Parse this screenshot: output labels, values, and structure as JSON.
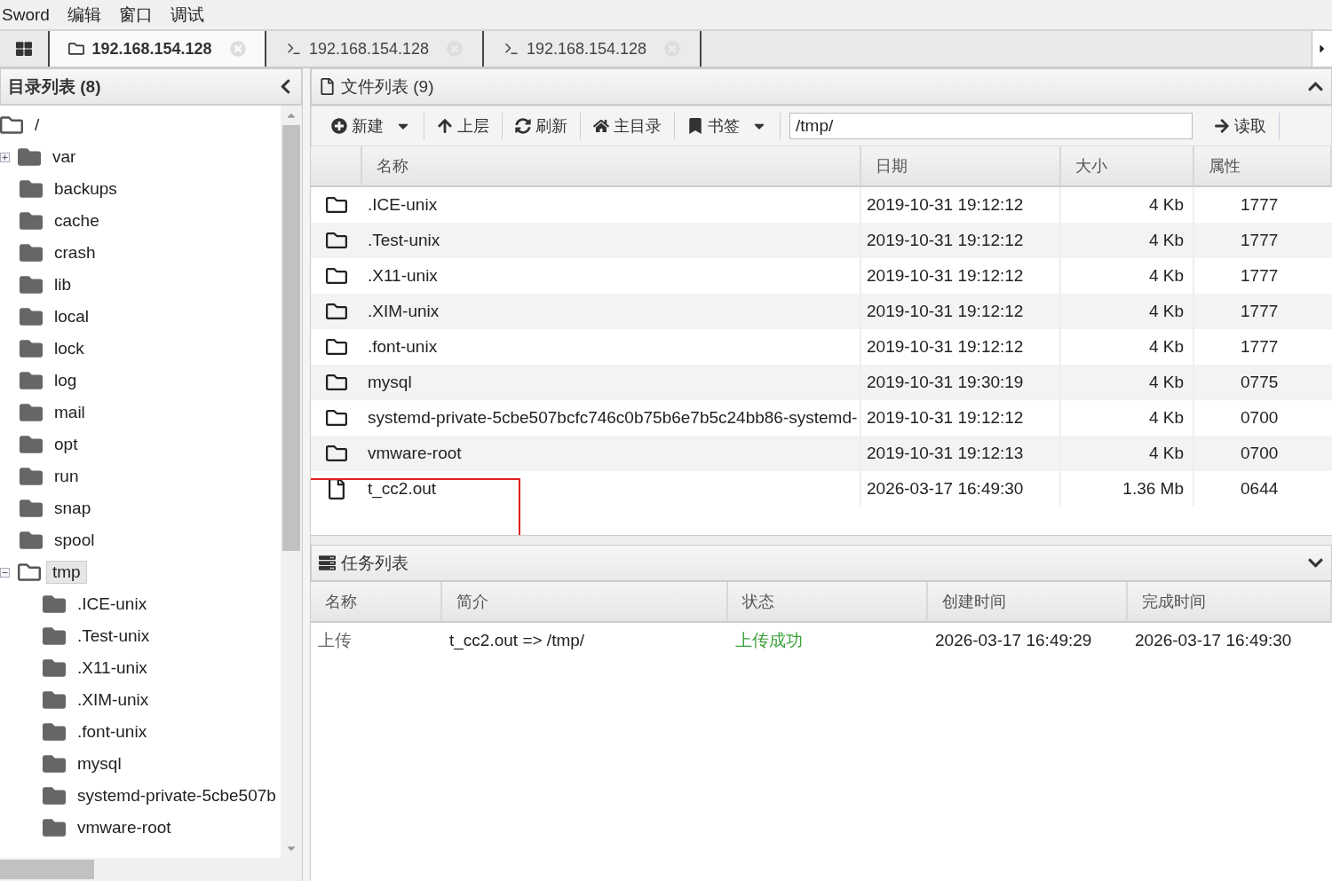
{
  "menu": [
    "Sword",
    "编辑",
    "窗口",
    "调试"
  ],
  "tabs": [
    {
      "kind": "files",
      "label": "192.168.154.128",
      "selected": true
    },
    {
      "kind": "terminal",
      "label": "192.168.154.128",
      "selected": false
    },
    {
      "kind": "terminal",
      "label": "192.168.154.128",
      "selected": false
    }
  ],
  "dir_panel": {
    "title": "目录列表 (8)",
    "tree": [
      {
        "label": "/",
        "expanded": true,
        "selected": false,
        "children": [
          {
            "label": "var",
            "expanded": false,
            "selected": false
          },
          {
            "label": "backups",
            "selected": false
          },
          {
            "label": "cache",
            "selected": false
          },
          {
            "label": "crash",
            "selected": false
          },
          {
            "label": "lib",
            "selected": false
          },
          {
            "label": "local",
            "selected": false
          },
          {
            "label": "lock",
            "selected": false
          },
          {
            "label": "log",
            "selected": false
          },
          {
            "label": "mail",
            "selected": false
          },
          {
            "label": "opt",
            "selected": false
          },
          {
            "label": "run",
            "selected": false
          },
          {
            "label": "snap",
            "selected": false
          },
          {
            "label": "spool",
            "selected": false
          },
          {
            "label": "tmp",
            "expanded": true,
            "selected": true,
            "children": [
              {
                "label": ".ICE-unix",
                "selected": false
              },
              {
                "label": ".Test-unix",
                "selected": false
              },
              {
                "label": ".X11-unix",
                "selected": false
              },
              {
                "label": ".XIM-unix",
                "selected": false
              },
              {
                "label": ".font-unix",
                "selected": false
              },
              {
                "label": "mysql",
                "selected": false
              },
              {
                "label": "systemd-private-5cbe507b",
                "selected": false
              },
              {
                "label": "vmware-root",
                "selected": false
              }
            ]
          }
        ]
      }
    ]
  },
  "file_panel": {
    "title": "文件列表 (9)",
    "toolbar": [
      {
        "kind": "new",
        "label": "新建",
        "dropdown": true
      },
      {
        "kind": "up",
        "label": "上层",
        "dropdown": false
      },
      {
        "kind": "refresh",
        "label": "刷新",
        "dropdown": false
      },
      {
        "kind": "home",
        "label": "主目录",
        "dropdown": false
      },
      {
        "kind": "bookmark",
        "label": "书签",
        "dropdown": true
      }
    ],
    "path": "/tmp/",
    "read_button": "读取",
    "columns": [
      "名称",
      "日期",
      "大小",
      "属性"
    ],
    "rows": [
      {
        "kind": "folder",
        "name": ".ICE-unix",
        "date": "2019-10-31 19:12:12",
        "size": "4 Kb",
        "attr": "1777"
      },
      {
        "kind": "folder",
        "name": ".Test-unix",
        "date": "2019-10-31 19:12:12",
        "size": "4 Kb",
        "attr": "1777"
      },
      {
        "kind": "folder",
        "name": ".X11-unix",
        "date": "2019-10-31 19:12:12",
        "size": "4 Kb",
        "attr": "1777"
      },
      {
        "kind": "folder",
        "name": ".XIM-unix",
        "date": "2019-10-31 19:12:12",
        "size": "4 Kb",
        "attr": "1777"
      },
      {
        "kind": "folder",
        "name": ".font-unix",
        "date": "2019-10-31 19:12:12",
        "size": "4 Kb",
        "attr": "1777"
      },
      {
        "kind": "folder",
        "name": "mysql",
        "date": "2019-10-31 19:30:19",
        "size": "4 Kb",
        "attr": "0775"
      },
      {
        "kind": "folder",
        "name": "systemd-private-5cbe507bcfc746c0b75b6e7b5c24bb86-systemd-",
        "date": "2019-10-31 19:12:12",
        "size": "4 Kb",
        "attr": "0700"
      },
      {
        "kind": "folder",
        "name": "vmware-root",
        "date": "2019-10-31 19:12:13",
        "size": "4 Kb",
        "attr": "0700"
      },
      {
        "kind": "file",
        "name": "t_cc2.out",
        "date": "2026-03-17 16:49:30",
        "size": "1.36 Mb",
        "attr": "0644"
      }
    ]
  },
  "task_panel": {
    "title": "任务列表",
    "columns": [
      "名称",
      "简介",
      "状态",
      "创建时间",
      "完成时间"
    ],
    "rows": [
      {
        "name": "上传",
        "summary": "t_cc2.out => /tmp/",
        "status": "上传成功",
        "success": true,
        "created": "2026-03-17 16:49:29",
        "finished": "2026-03-17 16:49:30"
      }
    ]
  }
}
